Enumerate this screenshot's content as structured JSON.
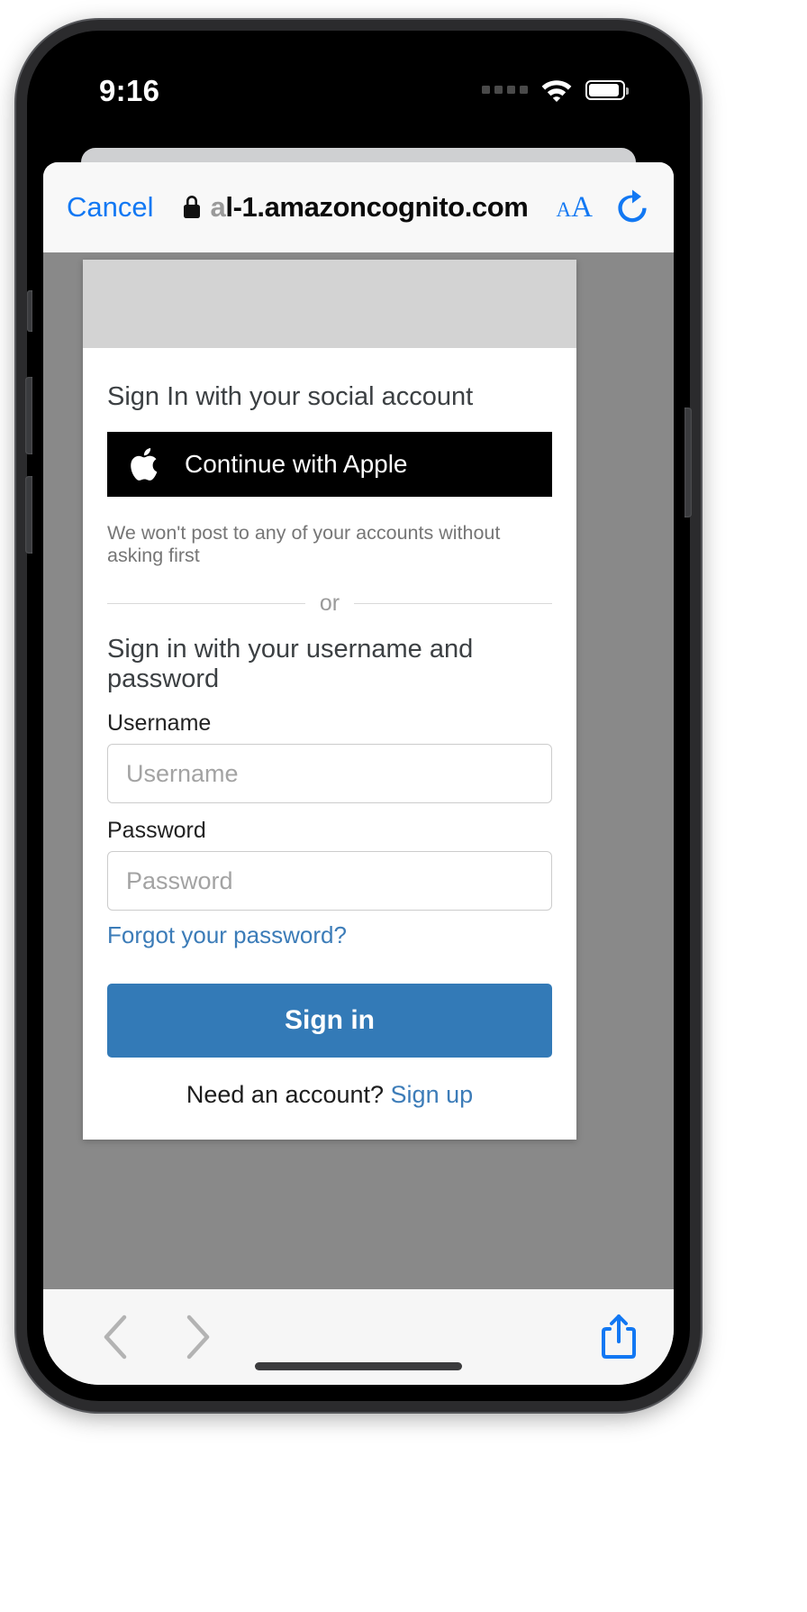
{
  "status_bar": {
    "time": "9:16",
    "signal_icon": "signal-dots-icon",
    "wifi_icon": "wifi-icon",
    "battery_icon": "battery-icon"
  },
  "browser": {
    "cancel_label": "Cancel",
    "lock_icon": "lock-icon",
    "url_dim_prefix": "a",
    "url_text": "l-1.amazoncognito.com",
    "aa_small": "A",
    "aa_big": "A",
    "reload_icon": "reload-icon",
    "bottom": {
      "back_icon": "chevron-left-icon",
      "forward_icon": "chevron-right-icon",
      "share_icon": "share-icon"
    }
  },
  "page": {
    "social_heading": "Sign In with your social account",
    "apple_button": {
      "icon": "apple-logo-icon",
      "label": "Continue with Apple"
    },
    "social_disclaimer": "We won't post to any of your accounts without asking first",
    "or_label": "or",
    "userpass_heading": "Sign in with your username and password",
    "username_label": "Username",
    "username_placeholder": "Username",
    "username_value": "",
    "password_label": "Password",
    "password_placeholder": "Password",
    "password_value": "",
    "forgot_password_link": "Forgot your password?",
    "signin_button": "Sign in",
    "signup_prompt": "Need an account? ",
    "signup_link": "Sign up"
  },
  "colors": {
    "ios_blue": "#1278f3",
    "cognito_primary": "#337ab7",
    "cognito_link": "#3c7cb8",
    "banner_grey": "#d3d3d3",
    "page_backdrop": "#898989"
  }
}
